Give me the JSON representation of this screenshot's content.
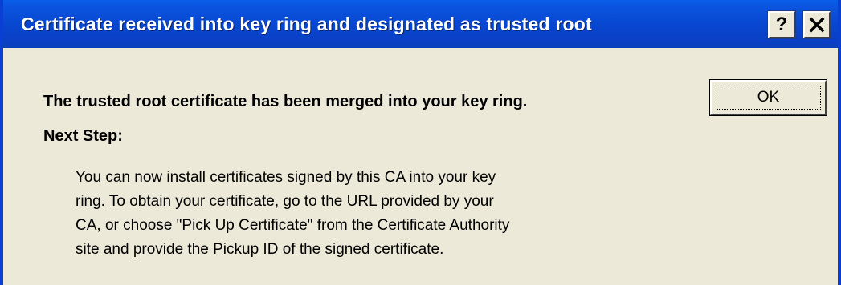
{
  "window": {
    "title": "Certificate received into key ring and designated as trusted root",
    "help_label": "?",
    "close_icon": "close-icon",
    "titlebar_color": "#0846cf",
    "body_color": "#ece9d8"
  },
  "content": {
    "message": "The trusted root certificate has been merged into your key ring.",
    "next_step_label": "Next Step:",
    "instructions": [
      "You can now install certificates signed by this CA into your key",
      "ring.  To obtain your certificate, go to the URL provided by your",
      "CA, or choose \"Pick Up Certificate\" from the Certificate Authority",
      "site and provide the Pickup ID of the signed certificate."
    ]
  },
  "buttons": {
    "ok_label": "OK"
  }
}
